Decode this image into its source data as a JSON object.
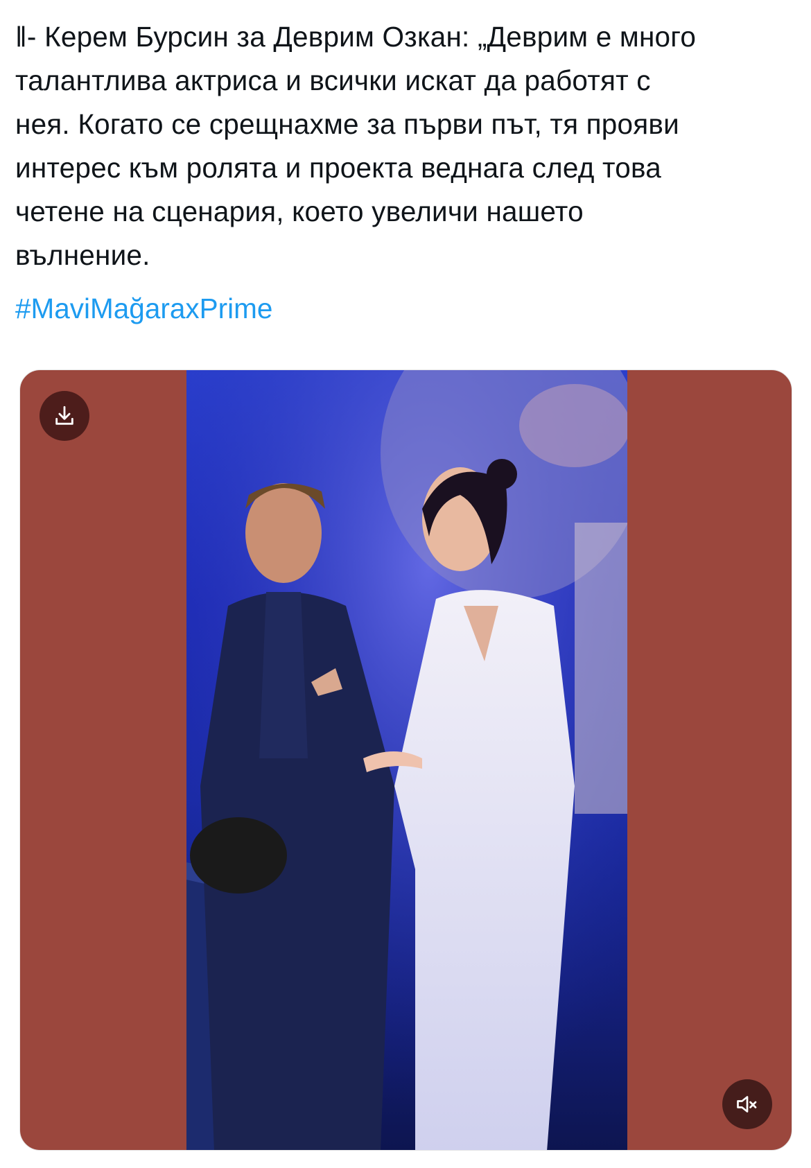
{
  "tweet": {
    "text_lines": [
      "‖- Керем Бурсин за Деврим Озкан: „Деврим е много",
      "талантлива актриса и всички искат да работят с",
      "нея. Когато се срещнахме за първи път, тя прояви",
      "интерес към ролята и проекта веднага след това",
      "четене на сценария, което увеличи нашето",
      "вълнение."
    ],
    "hashtag": "#MaviMağaraxPrime"
  },
  "media": {
    "type": "video",
    "controls": {
      "download_icon": "download-icon",
      "mute_icon": "volume-muted-icon"
    }
  },
  "colors": {
    "text": "#0f1419",
    "hashtag": "#1d9bf0",
    "media_background": "#9b473d"
  }
}
